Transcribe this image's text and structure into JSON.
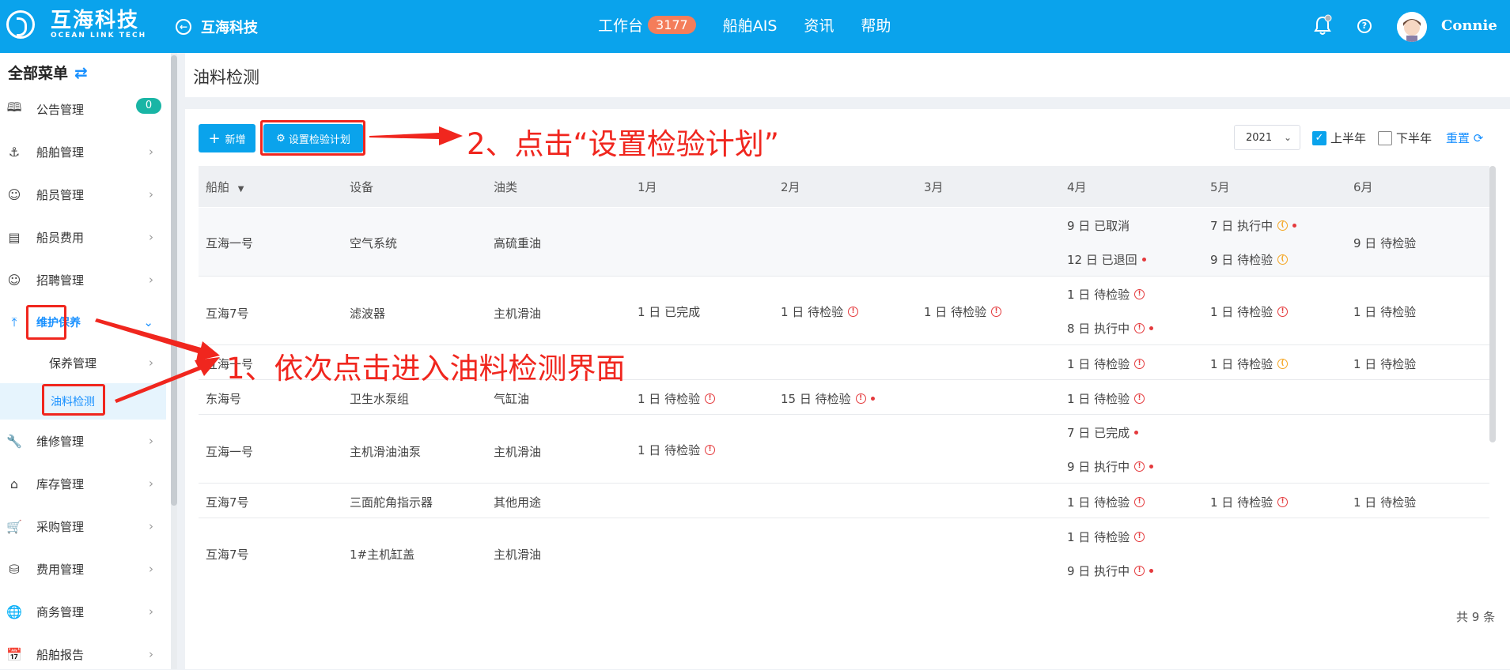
{
  "header": {
    "logo_cn": "互海科技",
    "logo_en": "OCEAN LINK TECH",
    "back_title": "互海科技",
    "nav": [
      {
        "label": "工作台",
        "badge": "3177"
      },
      {
        "label": "船舶AIS"
      },
      {
        "label": "资讯"
      },
      {
        "label": "帮助"
      }
    ],
    "user": "Connie"
  },
  "sidebar": {
    "title": "全部菜单",
    "badge_count": "0",
    "items": [
      {
        "label": "公告管理",
        "icon": "book-icon"
      },
      {
        "label": "船舶管理",
        "icon": "anchor-icon"
      },
      {
        "label": "船员管理",
        "icon": "person-icon"
      },
      {
        "label": "船员费用",
        "icon": "wallet-icon"
      },
      {
        "label": "招聘管理",
        "icon": "recruit-icon"
      },
      {
        "label": "维护保养",
        "icon": "maintenance-icon"
      },
      {
        "label": "保养管理"
      },
      {
        "label": "油料检测"
      },
      {
        "label": "维修管理",
        "icon": "wrench-icon"
      },
      {
        "label": "库存管理",
        "icon": "warehouse-icon"
      },
      {
        "label": "采购管理",
        "icon": "cart-icon"
      },
      {
        "label": "费用管理",
        "icon": "coins-icon"
      },
      {
        "label": "商务管理",
        "icon": "globe-icon"
      },
      {
        "label": "船舶报告",
        "icon": "calendar-icon"
      }
    ]
  },
  "page": {
    "title": "油料检测",
    "add_label": "新增",
    "plan_label": "设置检验计划",
    "year": "2021",
    "first_half": "上半年",
    "second_half": "下半年",
    "reset": "重置",
    "total": "共 9 条"
  },
  "table": {
    "headers": [
      "船舶",
      "设备",
      "油类",
      "1月",
      "2月",
      "3月",
      "4月",
      "5月",
      "6月"
    ],
    "rows": [
      {
        "ship": "互海一号",
        "device": "空气系统",
        "oil": "高硫重油"
      },
      {
        "ship": "互海7号",
        "device": "滤波器",
        "oil": "主机滑油"
      },
      {
        "ship": "互海一号",
        "device": "",
        "oil": ""
      },
      {
        "ship": "东海号",
        "device": "卫生水泵组",
        "oil": "气缸油"
      },
      {
        "ship": "互海一号",
        "device": "主机滑油油泵",
        "oil": "主机滑油"
      },
      {
        "ship": "互海7号",
        "device": "三面舵角指示器",
        "oil": "其他用途"
      },
      {
        "ship": "互海7号",
        "device": "1#主机缸盖",
        "oil": "主机滑油"
      }
    ],
    "entries": {
      "r0_apr_a": "9 日 已取消",
      "r0_apr_b": "12 日 已退回",
      "r0_may_a": "7 日 执行中",
      "r0_may_b": "9 日 待检验",
      "r0_jun": "9 日 待检验",
      "r1_jan": "1 日 已完成",
      "r1_feb": "1 日 待检验",
      "r1_mar": "1 日 待检验",
      "r1_apr_a": "1 日 待检验",
      "r1_apr_b": "8 日 执行中",
      "r1_may": "1 日 待检验",
      "r1_jun": "1 日 待检验",
      "r2_apr": "1 日 待检验",
      "r2_may": "1 日 待检验",
      "r2_jun": "1 日 待检验",
      "r3_jan": "1 日 待检验",
      "r3_feb": "15 日 待检验",
      "r3_apr": "1 日 待检验",
      "r4_jan": "1 日 待检验",
      "r4_apr_a": "7 日 已完成",
      "r4_apr_b": "9 日 执行中",
      "r5_apr": "1 日 待检验",
      "r5_may": "1 日 待检验",
      "r5_jun": "1 日 待检验",
      "r6_apr_a": "1 日 待检验",
      "r6_apr_b": "9 日 执行中"
    }
  },
  "annotations": {
    "step1": "1、依次点击进入油料检测界面",
    "step2": "2、点击“设置检验计划”"
  },
  "colors": {
    "brand": "#0aa3ec",
    "annotation": "#f0261e",
    "badge": "#f47d5a",
    "status_red": "#e4393c",
    "status_orange": "#f5a623"
  }
}
